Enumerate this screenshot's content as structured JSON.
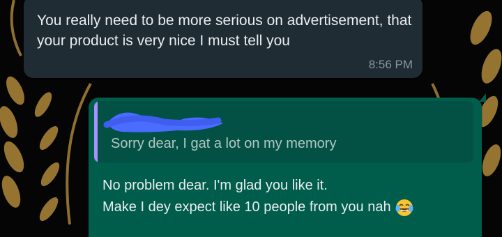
{
  "incoming_message": {
    "text": "You really need to be more serious on advertisement, that your product is very nice I must tell you",
    "time": "8:56 PM"
  },
  "outgoing_message": {
    "quoted_text": "Sorry dear, I gat a lot on my memory",
    "line1": "No problem dear. I'm glad you like it.",
    "line2": "Make I dey expect like 10 people from you nah",
    "emoji": "face-with-tears-of-joy"
  },
  "colors": {
    "incoming_bubble": "#1f2c34",
    "outgoing_bubble": "#005c4b",
    "quote_accent": "#a791ff",
    "redaction": "#4a6cff",
    "wallpaper_gold": "#b08a3a"
  }
}
